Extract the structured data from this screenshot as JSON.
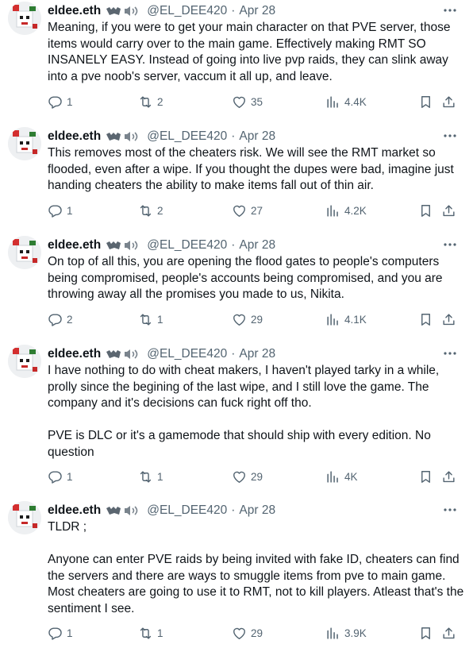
{
  "tweets": [
    {
      "name": "eldee.eth",
      "badge": "🦇🔊",
      "handle": "@EL_DEE420",
      "dot": "·",
      "date": "Apr 28",
      "text": "Meaning, if you were to get your main character on that PVE server, those items would carry over to the main game. Effectively making RMT SO INSANELY EASY. Instead of going into live pvp raids, they can slink away into a pve noob's server, vaccum it all up, and leave.",
      "replies": "1",
      "reposts": "2",
      "likes": "35",
      "views": "4.4K"
    },
    {
      "name": "eldee.eth",
      "badge": "🦇🔊",
      "handle": "@EL_DEE420",
      "dot": "·",
      "date": "Apr 28",
      "text": "This removes most of the cheaters risk. We will see the RMT market so flooded, even after a wipe. If you thought the dupes were bad, imagine just handing cheaters the ability to make items fall out of thin air.",
      "replies": "1",
      "reposts": "2",
      "likes": "27",
      "views": "4.2K"
    },
    {
      "name": "eldee.eth",
      "badge": "🦇🔊",
      "handle": "@EL_DEE420",
      "dot": "·",
      "date": "Apr 28",
      "text": "On top of all this, you are opening the flood gates to people's computers being compromised, people's accounts being compromised, and you are throwing away all the promises you made to us, Nikita.",
      "replies": "2",
      "reposts": "1",
      "likes": "29",
      "views": "4.1K"
    },
    {
      "name": "eldee.eth",
      "badge": "🦇🔊",
      "handle": "@EL_DEE420",
      "dot": "·",
      "date": "Apr 28",
      "text": "I have nothing to do with cheat makers, I haven't played tarky in a while, prolly since the begining of the last wipe, and I still love the game. The company and it's decisions can fuck right off tho.\n\nPVE is DLC or it's a gamemode that should ship with every edition. No question",
      "replies": "1",
      "reposts": "1",
      "likes": "29",
      "views": "4K"
    },
    {
      "name": "eldee.eth",
      "badge": "🦇🔊",
      "handle": "@EL_DEE420",
      "dot": "·",
      "date": "Apr 28",
      "text": "TLDR ;\n\nAnyone can enter PVE raids by being invited with fake ID, cheaters can find the servers and there are ways to smuggle items from pve to main game. Most cheaters are going to use it to RMT, not to kill players. Atleast that's the sentiment I see.",
      "replies": "1",
      "reposts": "1",
      "likes": "29",
      "views": "3.9K"
    }
  ],
  "icons": {
    "more": "more-dots-icon",
    "reply": "reply-bubble-icon",
    "repost": "repost-arrows-icon",
    "like": "heart-icon",
    "views": "views-bar-chart-icon",
    "bookmark": "bookmark-icon",
    "share": "share-upload-icon",
    "avatar": "pixel-ghost-avatar",
    "badge": "bat-speaker-emoji"
  },
  "colors": {
    "text": "#0f1419",
    "secondary": "#536471",
    "background": "#ffffff"
  }
}
